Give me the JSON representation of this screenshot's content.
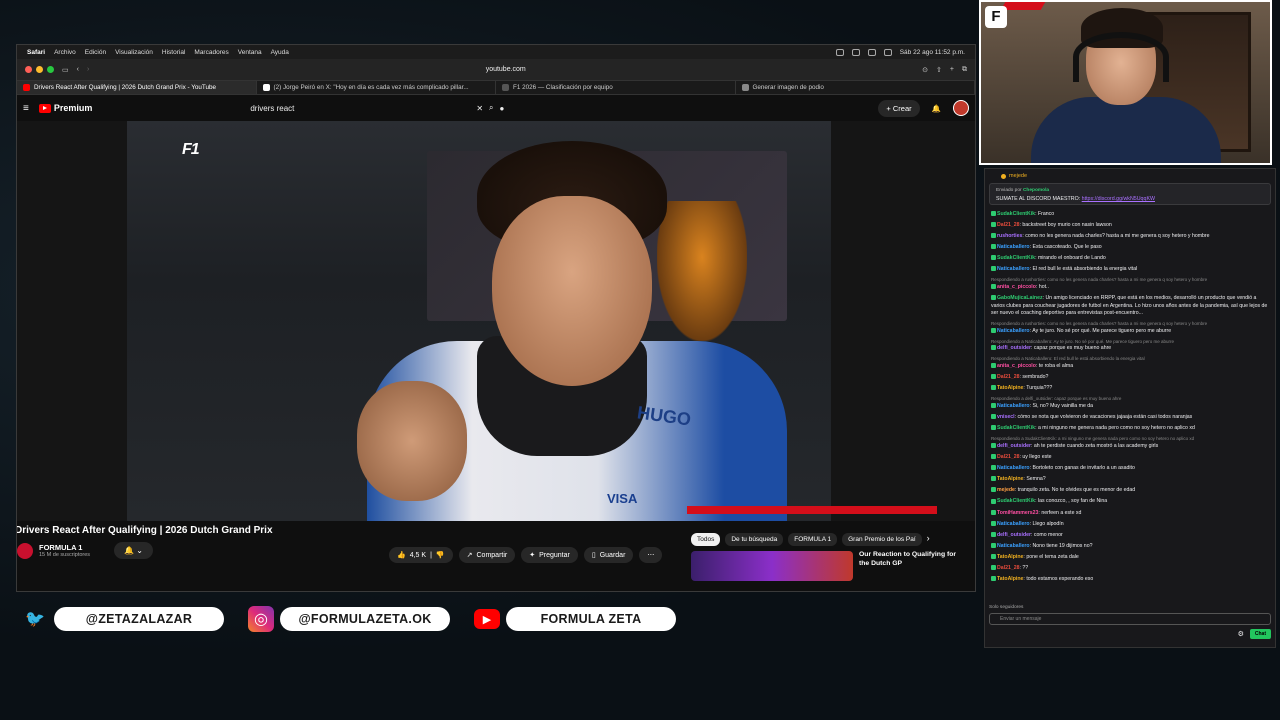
{
  "menubar": {
    "app": "Safari",
    "items": [
      "Archivo",
      "Edición",
      "Visualización",
      "Historial",
      "Marcadores",
      "Ventana",
      "Ayuda"
    ],
    "clock": "Sáb 22 ago 11:52 p.m."
  },
  "toolbar": {
    "url": "youtube.com"
  },
  "tabs": [
    {
      "label": "Drivers React After Qualifying | 2026 Dutch Grand Prix - YouTube",
      "color": "#ff0000"
    },
    {
      "label": "(2) Jorge Peiró en X: \"Hoy en día es cada vez más complicado pillar...",
      "color": "#ffffff"
    },
    {
      "label": "F1 2026 — Clasificación por equipo",
      "color": "#555555"
    },
    {
      "label": "Generar imagen de podio",
      "color": "#888888"
    }
  ],
  "youtube": {
    "brand": "Premium",
    "search_query": "drivers react",
    "create_label": "Crear",
    "video_overlay_logo": "F1",
    "jacket_text": "HUGO",
    "sponsor_text": "VISA",
    "title": "Drivers React After Qualifying | 2026 Dutch Grand Prix",
    "channel": "FORMULA 1",
    "subscribers": "15 M de suscriptores",
    "likes": "4,5 K",
    "share": "Compartir",
    "ask": "Preguntar",
    "save": "Guardar",
    "chips": [
      "Todos",
      "De tu búsqueda",
      "FORMULA 1",
      "Gran Premio de los Paí"
    ],
    "rec_title": "Our Reaction to Qualifying for the Dutch GP"
  },
  "chat": {
    "top_user": "mejede",
    "pinned_by_prefix": "Enviado por",
    "pinned_by": "Chepomola",
    "pinned_msg": "SUMATE AL DISCORD MAESTRO:",
    "pinned_link": "https://discord.gg/wkN5UqqKW",
    "messages": [
      {
        "reply": "",
        "user": "SudakClientKik",
        "color": "#2ecc71",
        "text": "Franco"
      },
      {
        "reply": "",
        "user": "Dal21_28",
        "color": "#e74c3c",
        "text": "backstreet boy murio con nasin lawson"
      },
      {
        "reply": "",
        "user": "rushorties",
        "color": "#a970ff",
        "text": "como no les genera nada charles? hasta a mi me genera q soy hetero y hombre"
      },
      {
        "reply": "",
        "user": "Naticaballero",
        "color": "#3aa0ff",
        "text": "Esta cascoteado. Que le paso"
      },
      {
        "reply": "",
        "user": "SudakClientKik",
        "color": "#2ecc71",
        "text": "mirando el onboard de Lando"
      },
      {
        "reply": "",
        "user": "Naticaballero",
        "color": "#3aa0ff",
        "text": "El red bull le está absorbiendo la energia vital"
      },
      {
        "reply": "Respondiendo a rushorties: como no les genera nada charles? hasta a mi me genera q soy hetero y hombre",
        "user": "anita_c_piccolo",
        "color": "#ff4fa3",
        "text": "hot.."
      },
      {
        "reply": "",
        "user": "GaboMujicaLainez",
        "color": "#2ecc71",
        "text": "Un amigo licenciado en RRPP, que está en los medios, desarrolló un producto que vendió a varios clubes para couchear jugadores de futbol en Argentina. Lo hizo unos años antes de la pandemia, así que lejos de ser nuevo el coaching deportivo para entrevistas post-encuentro..."
      },
      {
        "reply": "Respondiendo a rushorties: como no les genera nada charles? hasta a mi me genera q soy hetero y hombre",
        "user": "Naticaballero",
        "color": "#3aa0ff",
        "text": "Ay te juro. No sé por qué. Me parece tiguero pero me aburre"
      },
      {
        "reply": "Respondiendo a Naticaballero: Ay te juro. No sé por qué. Me parece tiguero pero me aburre",
        "user": "delfi_outsider",
        "color": "#a970ff",
        "text": "capaz porque es muy bueno ahre"
      },
      {
        "reply": "Respondiendo a Naticaballero: El red bull le está absorbiendo la energia vital",
        "user": "anita_c_piccolo",
        "color": "#ff4fa3",
        "text": "te roba el alma"
      },
      {
        "reply": "",
        "user": "Dal21_28",
        "color": "#e74c3c",
        "text": "sembrado?"
      },
      {
        "reply": "",
        "user": "TatoAlpine",
        "color": "#f0b020",
        "text": "Turquia???"
      },
      {
        "reply": "Respondiendo a delfi_outsider: capaz porque es muy bueno ahre",
        "user": "Naticaballero",
        "color": "#3aa0ff",
        "text": "Si, no? Muy vainilla me da"
      },
      {
        "reply": "",
        "user": "vnisecl",
        "color": "#a970ff",
        "text": "cómo se nota que volvieron de vacaciones jajaaja están casi todos naranjas"
      },
      {
        "reply": "",
        "user": "SudakClientKik",
        "color": "#2ecc71",
        "text": "a mi ninguno me genera nada pero como no soy hetero no aplico xd"
      },
      {
        "reply": "Respondiendo a SudakClientKik: a mi ninguno me genera nada pero como no soy hetero no aplico xd",
        "user": "delfi_outsider",
        "color": "#a970ff",
        "text": "ah te perdiste cuando zeta mostró a las academy girls"
      },
      {
        "reply": "",
        "user": "Dal21_28",
        "color": "#e74c3c",
        "text": "uy llego este"
      },
      {
        "reply": "",
        "user": "Naticaballero",
        "color": "#3aa0ff",
        "text": "Bortoleto con ganas de invitarlo a un asadito"
      },
      {
        "reply": "",
        "user": "TatoAlpine",
        "color": "#f0b020",
        "text": "Semna?"
      },
      {
        "reply": "",
        "user": "mejede",
        "color": "#ff9f43",
        "text": "tranquilo zeta. No te olvides que es menor de edad"
      },
      {
        "reply": "",
        "user": "SudakClientKik",
        "color": "#2ecc71",
        "text": "las conozco, , soy fan de Nina"
      },
      {
        "reply": "",
        "user": "TomiHammers23",
        "color": "#ff4fa3",
        "text": "nerfeen a este xd"
      },
      {
        "reply": "",
        "user": "Naticaballero",
        "color": "#3aa0ff",
        "text": "Llego alpodín"
      },
      {
        "reply": "",
        "user": "delfi_outsider",
        "color": "#a970ff",
        "text": "como menor"
      },
      {
        "reply": "",
        "user": "Naticaballero",
        "color": "#3aa0ff",
        "text": "Nono tiene 19 dijimos no?"
      },
      {
        "reply": "",
        "user": "TatoAlpine",
        "color": "#f0b020",
        "text": "pone el tema zeta dale"
      },
      {
        "reply": "",
        "user": "Dal21_28",
        "color": "#e74c3c",
        "text": "??"
      },
      {
        "reply": "",
        "user": "TatoAlpine",
        "color": "#f0b020",
        "text": "todo estamos esperando eso"
      }
    ],
    "followers_label": "Solo seguidores",
    "input_placeholder": "Enviar un mensaje",
    "send_label": "Chat"
  },
  "socials": [
    {
      "icon": "twitter-icon",
      "glyph": "🐦",
      "color": "#1da1f2",
      "handle": "@ZETAZALAZAR"
    },
    {
      "icon": "instagram-icon",
      "glyph": "◎",
      "color": "#e1306c",
      "handle": "@FORMULAZETA.OK"
    },
    {
      "icon": "youtube-icon",
      "glyph": "▶",
      "color": "#ff0000",
      "handle": "FORMULA ZETA"
    }
  ]
}
